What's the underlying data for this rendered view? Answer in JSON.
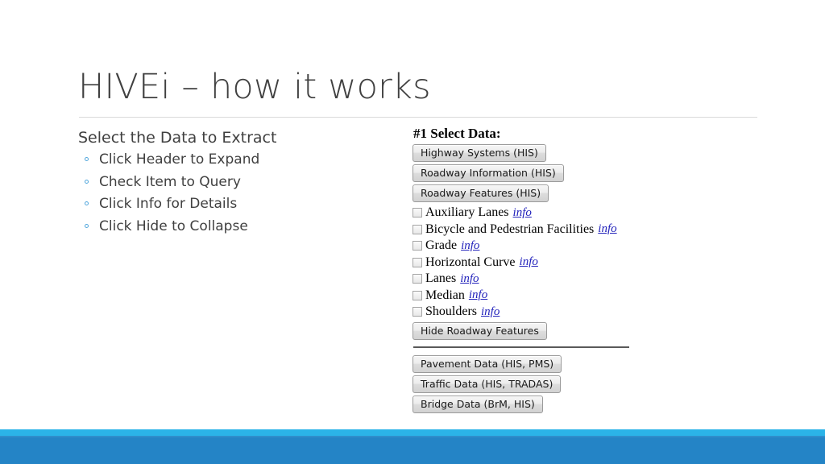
{
  "slide": {
    "title": "HIVEi – how it works"
  },
  "bullets": {
    "heading": "Select the Data to Extract",
    "items": [
      {
        "label": "Click Header to Expand"
      },
      {
        "label": "Check Item to Query"
      },
      {
        "label": "Click Info for Details"
      },
      {
        "label": "Click Hide to Collapse"
      }
    ]
  },
  "app": {
    "heading": "#1 Select Data:",
    "top_buttons": [
      {
        "label": "Highway Systems (HIS)"
      },
      {
        "label": "Roadway Information (HIS)"
      },
      {
        "label": "Roadway Features (HIS)"
      }
    ],
    "checkboxes": [
      {
        "label": "Auxiliary Lanes",
        "info": "info",
        "checked": false
      },
      {
        "label": "Bicycle and Pedestrian Facilities",
        "info": "info",
        "checked": false
      },
      {
        "label": "Grade",
        "info": "info",
        "checked": false
      },
      {
        "label": "Horizontal Curve",
        "info": "info",
        "checked": false
      },
      {
        "label": "Lanes",
        "info": "info",
        "checked": false
      },
      {
        "label": "Median",
        "info": "info",
        "checked": false
      },
      {
        "label": "Shoulders",
        "info": "info",
        "checked": false
      }
    ],
    "hide_button": {
      "label": "Hide Roadway Features"
    },
    "bottom_buttons": [
      {
        "label": "Pavement Data (HIS, PMS)"
      },
      {
        "label": "Traffic Data (HIS, TRADAS)"
      },
      {
        "label": "Bridge Data (BrM, HIS)"
      }
    ]
  },
  "colors": {
    "title_text": "#404040",
    "bullet_marker": "#52a7dc",
    "info_link": "#2222bb",
    "footer_stripe": "#2bb3e8",
    "footer_band": "#2484c6",
    "rule": "#d9d9d9"
  }
}
